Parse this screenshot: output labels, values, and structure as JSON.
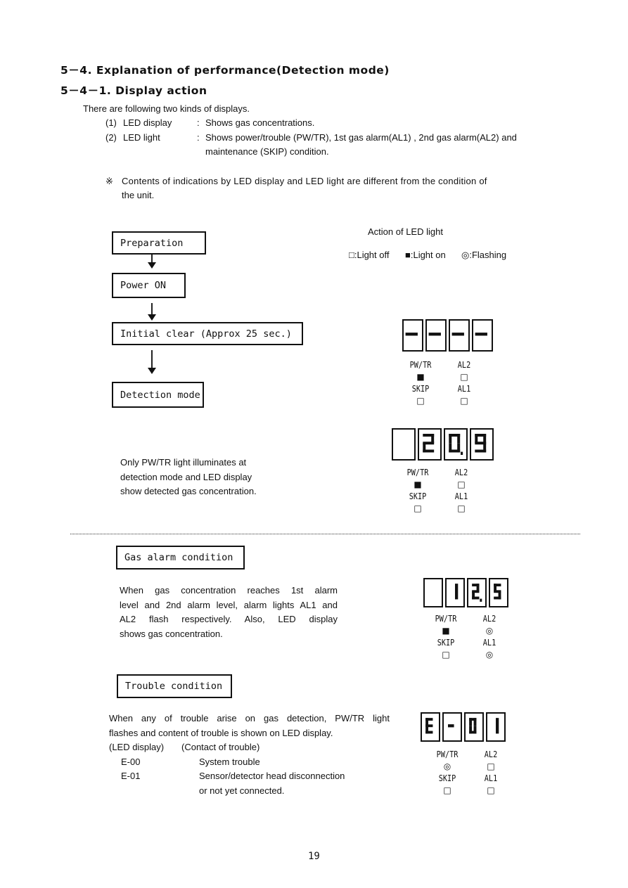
{
  "section": {
    "title": "5－4. Explanation of performance(Detection mode)",
    "subtitle": "5－4－1. Display action"
  },
  "intro": {
    "lead": "There are following two kinds of displays.",
    "items": [
      {
        "num": "(1)",
        "term": "LED display",
        "sep": ":",
        "desc": "Shows gas concentrations.",
        "desc2": ""
      },
      {
        "num": "(2)",
        "term": "LED light",
        "sep": ":",
        "desc": "Shows power/trouble (PW/TR), 1st gas alarm(AL1) , 2nd gas alarm(AL2) and",
        "desc2": "maintenance (SKIP) condition."
      }
    ],
    "note_mark": "※",
    "note_line1": "Contents of indications by LED display and LED light are different from the condition of",
    "note_line2": "the unit."
  },
  "legend": {
    "title": "Action of LED light",
    "off": "□:Light off",
    "on": "■:Light on",
    "flash": "◎:Flashing"
  },
  "flow": {
    "steps": [
      "Preparation",
      "Power ON",
      "Initial clear (Approx 25 sec.)",
      "Detection mode"
    ]
  },
  "symbols": {
    "off": "□",
    "on": "■",
    "flash": "◎"
  },
  "panels": [
    {
      "name": "initial-clear",
      "digits": [
        "-",
        "-",
        "-",
        "-"
      ],
      "decimal_after": -1,
      "lamps": {
        "pw_tr": "on",
        "al2": "off",
        "skip": "off",
        "al1": "off"
      }
    },
    {
      "name": "detection",
      "digits": [
        " ",
        "2",
        "0",
        "9"
      ],
      "decimal_after": 2,
      "lamps": {
        "pw_tr": "on",
        "al2": "off",
        "skip": "off",
        "al1": "off"
      }
    },
    {
      "name": "gas-alarm",
      "digits": [
        " ",
        "1",
        "2",
        "5"
      ],
      "decimal_after": 2,
      "lamps": {
        "pw_tr": "on",
        "al2": "flash",
        "skip": "off",
        "al1": "flash"
      }
    },
    {
      "name": "trouble",
      "digits": [
        "E",
        "-",
        "0",
        "1"
      ],
      "decimal_after": -1,
      "lamps": {
        "pw_tr": "flash",
        "al2": "off",
        "skip": "off",
        "al1": "off"
      }
    }
  ],
  "lamp_labels": {
    "pw_tr": "PW/TR",
    "al2": "AL2",
    "skip": "SKIP",
    "al1": "AL1"
  },
  "detection_note": [
    "Only PW/TR light illuminates at",
    "detection mode and LED display",
    "show detected gas concentration."
  ],
  "gas_alarm": {
    "heading": "Gas alarm condition",
    "lines": [
      "When gas concentration reaches 1st alarm",
      "level and 2nd alarm level, alarm lights AL1 and",
      "AL2 flash respectively. Also, LED display",
      "shows gas concentration."
    ]
  },
  "trouble": {
    "heading": "Trouble condition",
    "lines": [
      "When any of trouble arise on gas detection, PW/TR light",
      "flashes and content of trouble is shown on LED display."
    ],
    "table_header": {
      "code": "(LED display)",
      "desc": "(Contact of trouble)"
    },
    "rows": [
      {
        "code": "E-00",
        "desc": "System trouble",
        "desc2": ""
      },
      {
        "code": "E-01",
        "desc": "Sensor/detector head disconnection",
        "desc2": "or not yet connected."
      }
    ]
  },
  "page_number": "19"
}
